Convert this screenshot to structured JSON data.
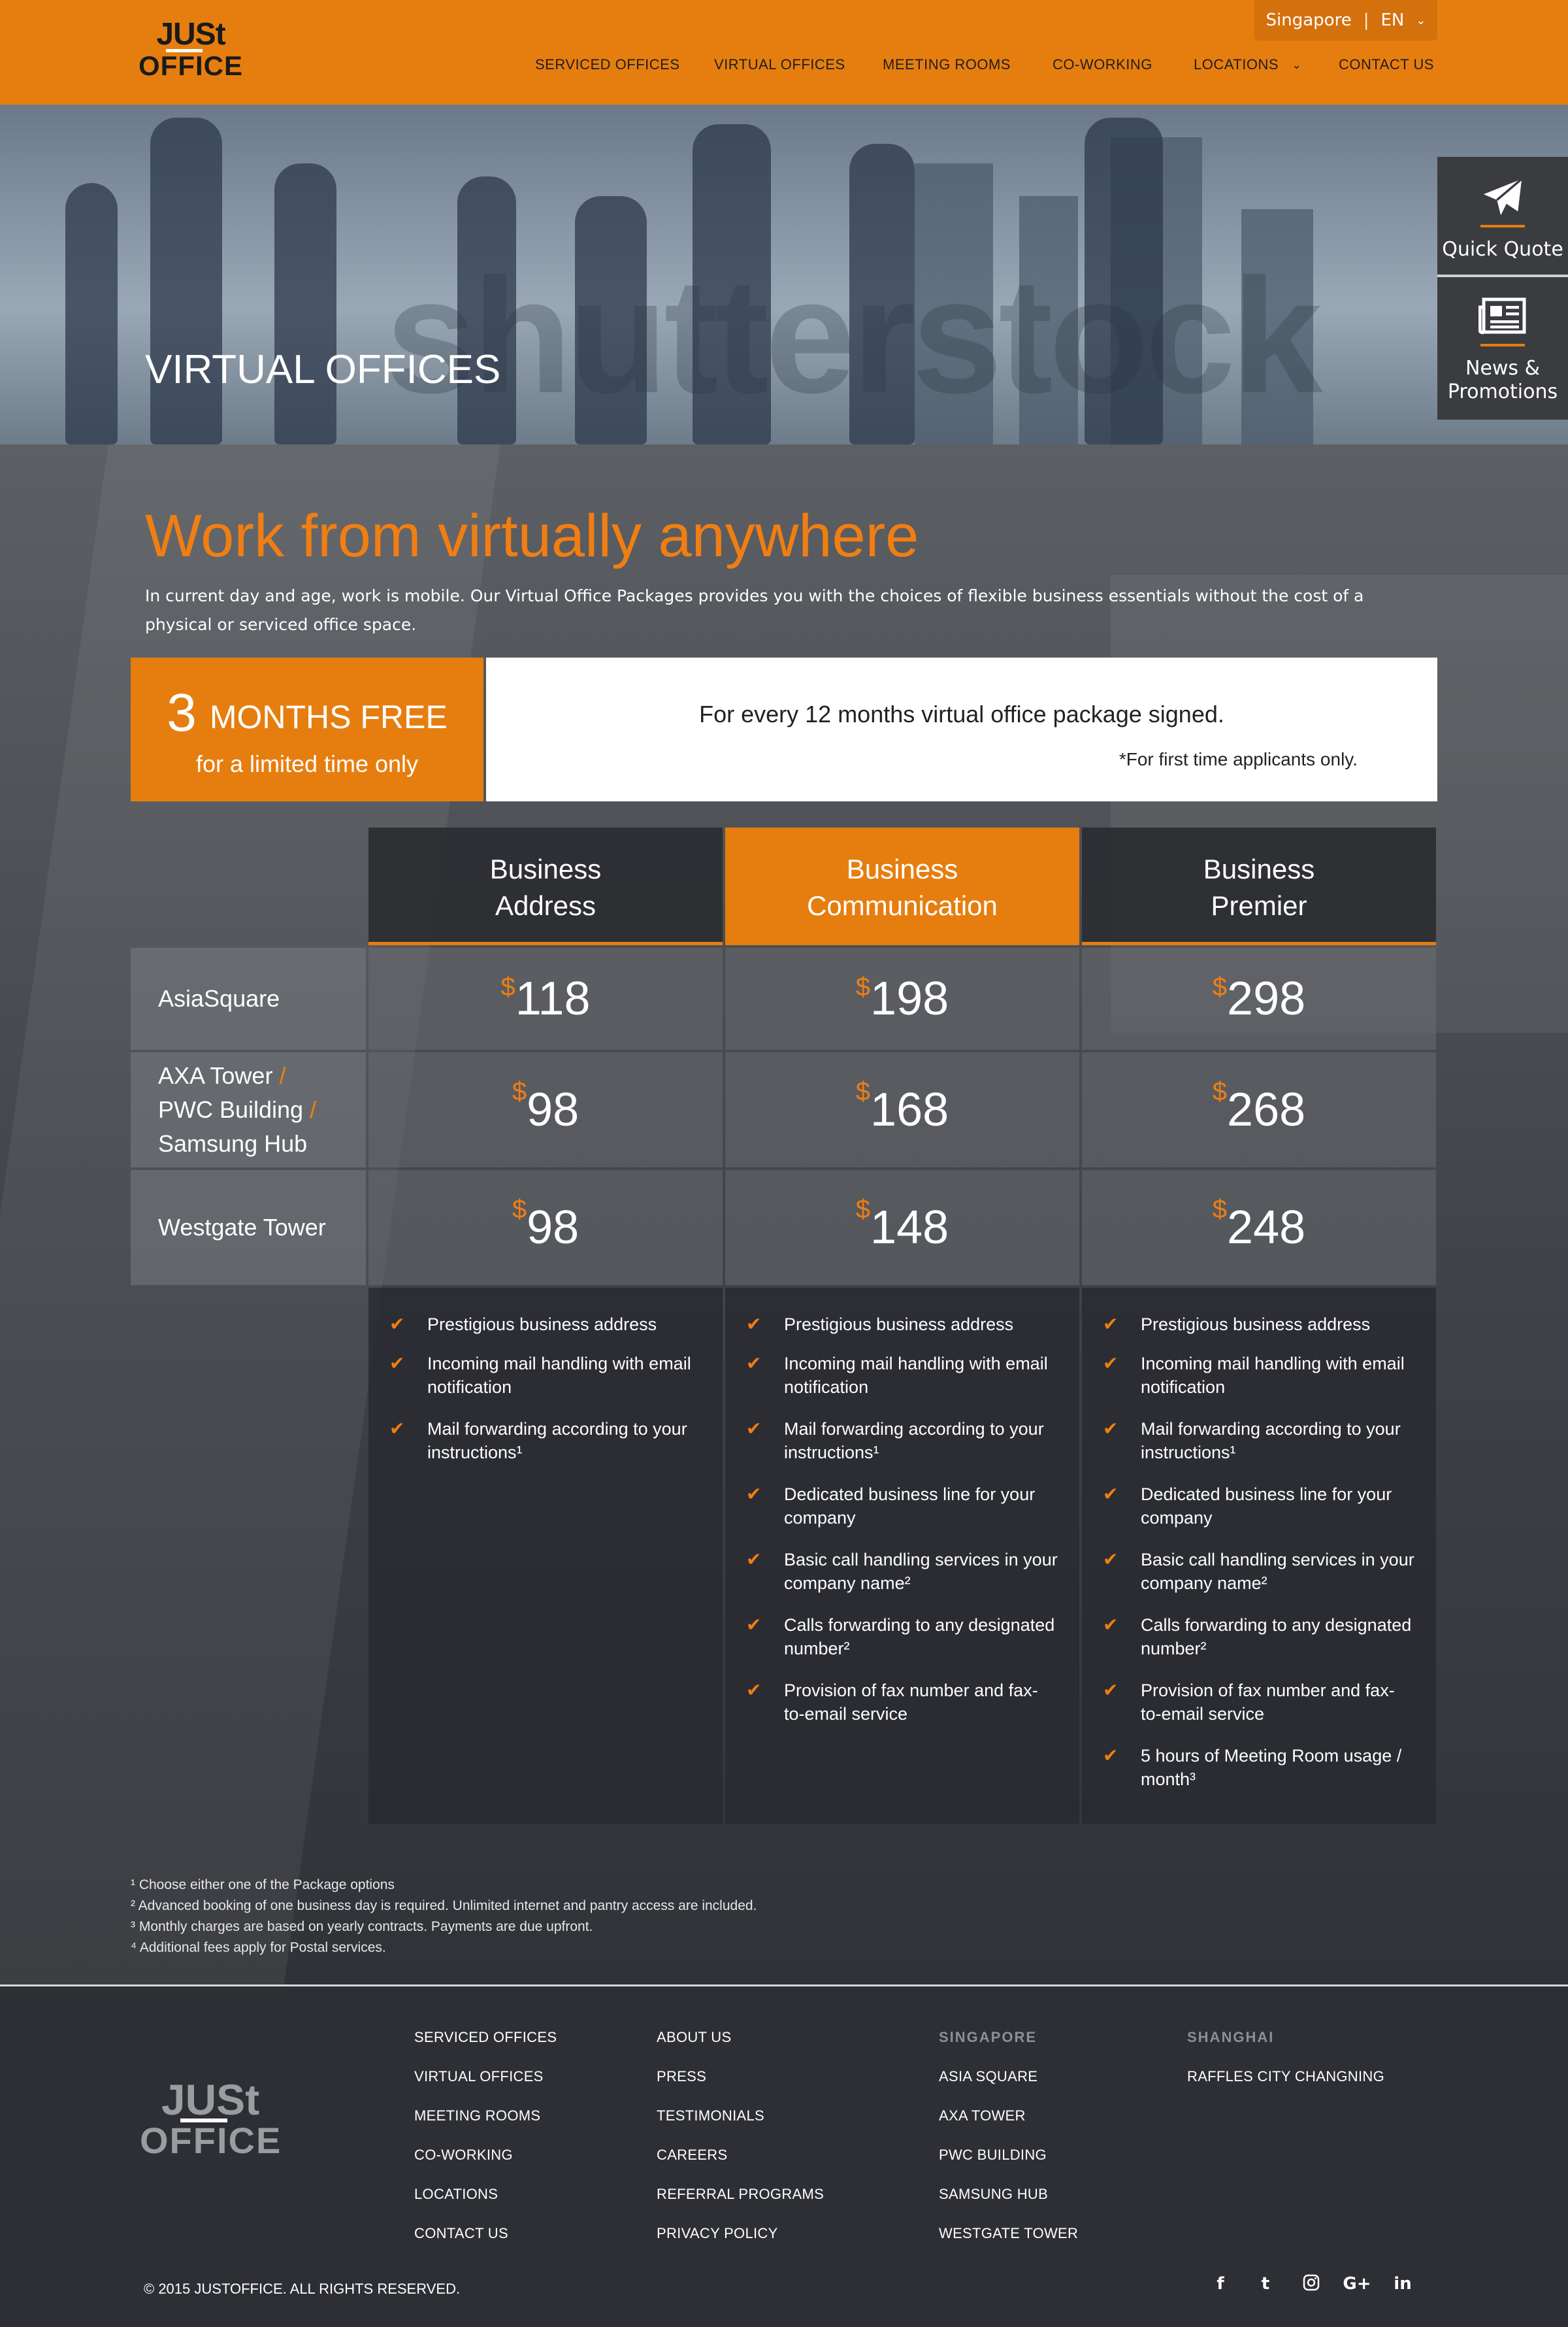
{
  "header": {
    "logo_line1": "JUSt",
    "logo_line2": "OFFICE",
    "locale": {
      "country": "Singapore",
      "separator": "|",
      "language": "EN"
    },
    "nav": [
      {
        "label": "SERVICED OFFICES"
      },
      {
        "label": "VIRTUAL OFFICES"
      },
      {
        "label": "MEETING ROOMS"
      },
      {
        "label": "CO-WORKING"
      },
      {
        "label": "LOCATIONS"
      },
      {
        "label": "CONTACT US"
      }
    ]
  },
  "hero": {
    "title": "VIRTUAL OFFICES",
    "watermark": "shutterstock"
  },
  "side_panel": {
    "quote_label": "Quick Quote",
    "news_line1": "News &",
    "news_line2": "Promotions"
  },
  "intro": {
    "tagline": "Work from virtually anywhere",
    "text": "In current day and age, work is mobile. Our Virtual Office Packages provides you with the choices of flexible business essentials without the cost of a physical or serviced office space."
  },
  "promo": {
    "number": "3",
    "headline": "MONTHS FREE",
    "sub": "for a limited time only",
    "line1": "For every 12 months virtual office package signed.",
    "line2": "*For first time applicants only."
  },
  "pricing": {
    "currency": "$",
    "packages": [
      {
        "line1": "Business",
        "line2": "Address"
      },
      {
        "line1": "Business",
        "line2": "Communication"
      },
      {
        "line1": "Business",
        "line2": "Premier"
      }
    ],
    "rows": [
      {
        "parts": [
          "AsiaSquare"
        ],
        "prices": [
          "118",
          "198",
          "298"
        ]
      },
      {
        "parts": [
          "AXA Tower",
          "PWC Building",
          "Samsung Hub"
        ],
        "prices": [
          "98",
          "168",
          "268"
        ]
      },
      {
        "parts": [
          "Westgate Tower"
        ],
        "prices": [
          "98",
          "148",
          "248"
        ]
      }
    ],
    "slash": "/",
    "features": [
      [
        "Prestigious business address",
        "Incoming mail handling with email notification",
        "Mail forwarding according to your instructions¹"
      ],
      [
        "Prestigious business address",
        "Incoming mail handling with email notification",
        "Mail forwarding according to your instructions¹",
        "Dedicated business line for your company",
        "Basic call handling services in your company name²",
        "Calls forwarding to any designated number²",
        "Provision of fax number and fax-to-email service"
      ],
      [
        "Prestigious business address",
        "Incoming mail handling with email notification",
        "Mail forwarding according to your instructions¹",
        "Dedicated business line for your company",
        "Basic call handling services in your company name²",
        "Calls forwarding to any designated number²",
        "Provision of fax number and fax-to-email service",
        "5 hours of Meeting Room usage / month³"
      ]
    ]
  },
  "notes": [
    "¹ Choose either one of the Package options",
    "² Advanced booking of one business day is required. Unlimited internet and pantry access are included.",
    "³ Monthly charges are based on yearly contracts. Payments are due upfront.",
    "⁴ Additional fees apply for Postal services."
  ],
  "footer": {
    "logo_line1": "JUSt",
    "logo_line2": "OFFICE",
    "col1": [
      "SERVICED OFFICES",
      "VIRTUAL OFFICES",
      "MEETING ROOMS",
      "CO-WORKING",
      "LOCATIONS",
      "CONTACT US"
    ],
    "col2": [
      "ABOUT US",
      "PRESS",
      "TESTIMONIALS",
      "CAREERS",
      "REFERRAL PROGRAMS",
      "PRIVACY POLICY"
    ],
    "col3_heading": "SINGAPORE",
    "col3": [
      "ASIA SQUARE",
      "AXA TOWER",
      "PWC BUILDING",
      "SAMSUNG HUB",
      "WESTGATE TOWER"
    ],
    "col4_heading": "SHANGHAI",
    "col4": [
      "RAFFLES CITY CHANGNING"
    ],
    "copyright": "© 2015 JUSTOFFICE. ALL RIGHTS RESERVED.",
    "social": [
      "f",
      "t",
      "ig",
      "G+",
      "in"
    ]
  },
  "colors": {
    "accent": "#e67e0f",
    "accent_text": "#f07e12",
    "footer_bg": "#2e2f34"
  }
}
